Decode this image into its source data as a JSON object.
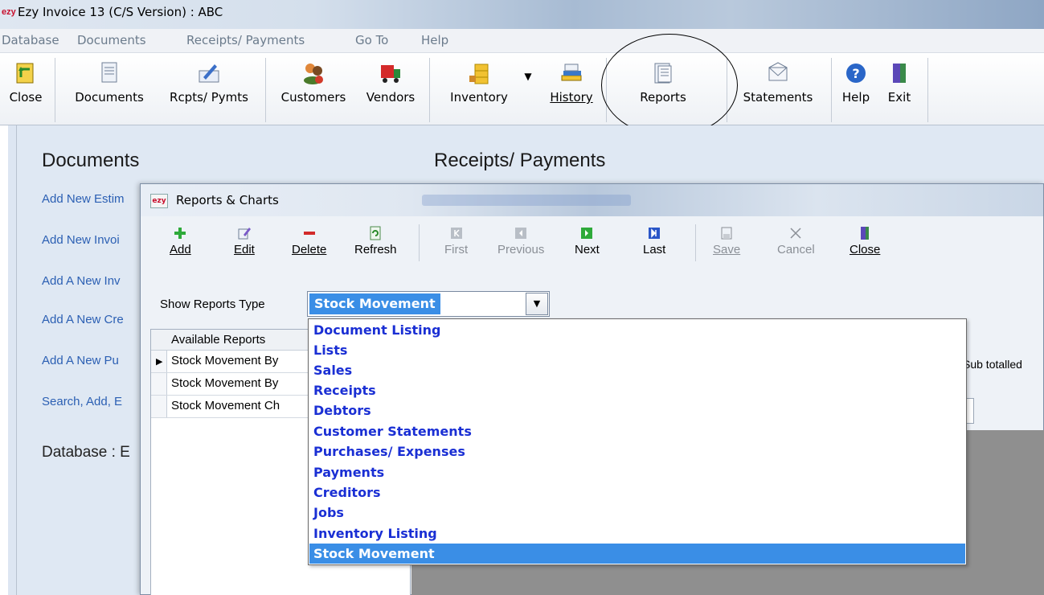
{
  "window": {
    "app_icon": "ezy",
    "title": "Ezy Invoice 13 (C/S Version) : ABC"
  },
  "menubar": [
    "Database",
    "Documents",
    "Receipts/ Payments",
    "Go To",
    "Help"
  ],
  "toolbar": {
    "close": "Close",
    "documents": "Documents",
    "rcpts_pymts": "Rcpts/ Pymts",
    "customers": "Customers",
    "vendors": "Vendors",
    "inventory": "Inventory",
    "history": "History",
    "reports": "Reports",
    "statements": "Statements",
    "help": "Help",
    "exit": "Exit"
  },
  "main": {
    "documents_title": "Documents",
    "receipts_title": "Receipts/ Payments",
    "links": [
      "Add New Estim",
      "Add New Invoi",
      "Add A New Inv",
      "Add A New Cre",
      "Add A New Pu",
      "Search, Add, E"
    ],
    "database_label": "Database : E"
  },
  "dialog": {
    "icon": "ezy",
    "title": "Reports & Charts",
    "toolbar": {
      "add": "Add",
      "edit": "Edit",
      "delete": "Delete",
      "refresh": "Refresh",
      "first": "First",
      "previous": "Previous",
      "next": "Next",
      "last": "Last",
      "save": "Save",
      "cancel": "Cancel",
      "close": "Close"
    },
    "show_reports_type_label": "Show Reports Type",
    "reports_type_value": "Stock Movement",
    "grid": {
      "header": "Available Reports",
      "rows": [
        "Stock Movement By",
        "Stock Movement By",
        "Stock Movement Ch"
      ]
    },
    "subtotal_text": "Sub totalled",
    "dropdown_options": [
      "Document Listing",
      "Lists",
      "Sales",
      "Receipts",
      "Debtors",
      "Customer Statements",
      "Purchases/ Expenses",
      "Payments",
      "Creditors",
      "Jobs",
      "Inventory Listing",
      "Stock Movement"
    ],
    "dropdown_selected": "Stock Movement"
  },
  "colors": {
    "accent": "#3a8ee6",
    "link": "#2b5fb3",
    "dropdown_text": "#1a2fd4"
  }
}
